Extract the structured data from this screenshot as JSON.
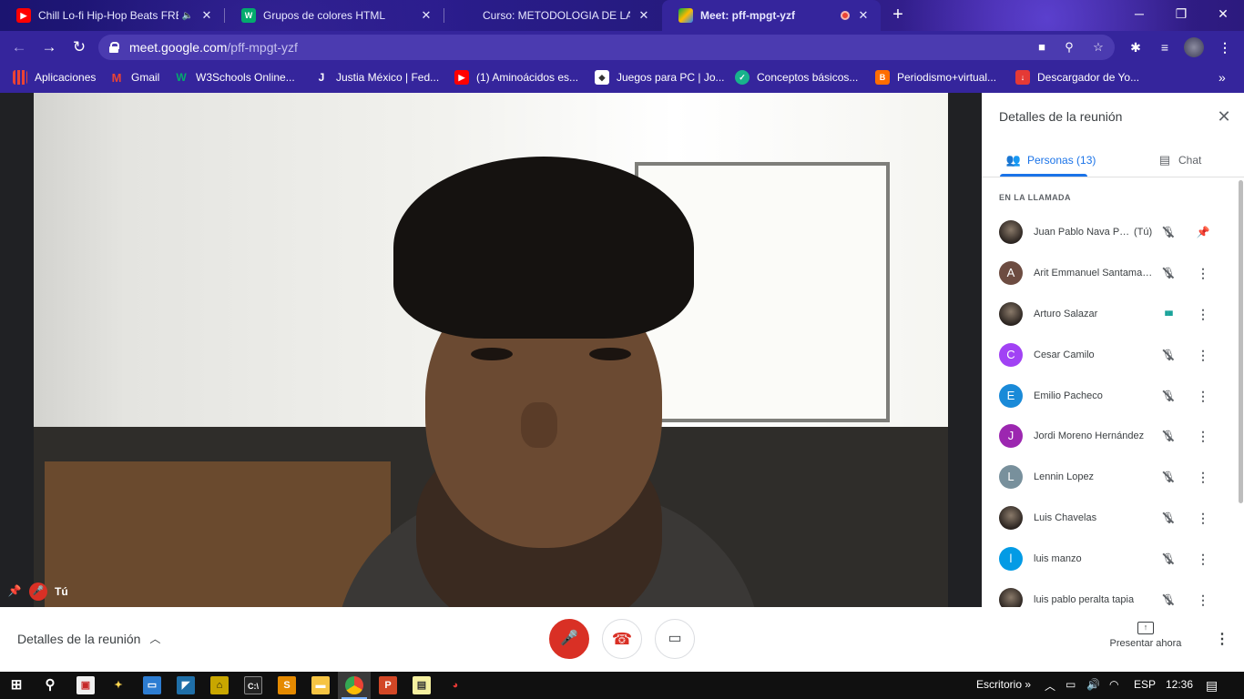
{
  "browser": {
    "tabs": [
      {
        "title": "Chill Lo-fi Hip-Hop Beats FREE",
        "icon": "youtube-icon",
        "audio": "🔈"
      },
      {
        "title": "Grupos de colores HTML",
        "icon": "w3schools-icon"
      },
      {
        "title": "Curso: METODOLOGIA DE LA INVESTIGACIÓN",
        "icon": "moodle-icon"
      },
      {
        "title": "Meet: pff-mpgt-yzf",
        "icon": "meet-icon",
        "recording": true
      }
    ],
    "url_host": "meet.google.com",
    "url_path": "/pff-mpgt-yzf",
    "bookmarks": [
      {
        "label": "Aplicaciones",
        "icon": "apps-grid-icon"
      },
      {
        "label": "Gmail",
        "icon": "gmail-icon"
      },
      {
        "label": "W3Schools Online...",
        "icon": "w3schools-icon"
      },
      {
        "label": "Justia México | Fed...",
        "icon": "justia-icon"
      },
      {
        "label": "(1) Aminoácidos es...",
        "icon": "youtube-icon"
      },
      {
        "label": "Juegos para PC | Jo...",
        "icon": "games-icon"
      },
      {
        "label": "Conceptos básicos...",
        "icon": "check-icon"
      },
      {
        "label": "Periodismo+virtual...",
        "icon": "blogger-icon"
      },
      {
        "label": "Descargador de Yo...",
        "icon": "download-icon"
      }
    ],
    "bookmarks_more": "»"
  },
  "meet": {
    "self_label": "Tú",
    "panel": {
      "title": "Detalles de la reunión",
      "tab_people": "Personas (13)",
      "tab_chat": "Chat",
      "section": "EN LA LLAMADA",
      "you_suffix": "(Tú)",
      "participants": [
        {
          "name": "Juan Pablo Nava Pa...",
          "initial": "",
          "color": "#5a4fc4",
          "photo": true,
          "you": true,
          "status": "muted"
        },
        {
          "name": "Arit Emmanuel Santamaría",
          "initial": "A",
          "color": "#6d4c41",
          "status": "muted"
        },
        {
          "name": "Arturo Salazar",
          "initial": "",
          "color": "#3e2f25",
          "photo": true,
          "status": "speaking"
        },
        {
          "name": "Cesar Camilo",
          "initial": "C",
          "color": "#a142f4",
          "status": "muted"
        },
        {
          "name": "Emilio Pacheco",
          "initial": "E",
          "color": "#1a8ad8",
          "status": "muted"
        },
        {
          "name": "Jordi Moreno Hernández",
          "initial": "J",
          "color": "#9c27b0",
          "status": "muted"
        },
        {
          "name": "Lennin Lopez",
          "initial": "L",
          "color": "#78909c",
          "status": "muted"
        },
        {
          "name": "Luis Chavelas",
          "initial": "",
          "color": "#4a5a6a",
          "photo": true,
          "status": "muted"
        },
        {
          "name": "luis manzo",
          "initial": "l",
          "color": "#039be5",
          "status": "muted"
        },
        {
          "name": "luis pablo peralta tapia",
          "initial": "",
          "color": "#b0b8c0",
          "photo": true,
          "status": "muted"
        }
      ]
    },
    "bottom": {
      "details_label": "Detalles de la reunión",
      "present_label": "Presentar ahora"
    }
  },
  "taskbar": {
    "desktop_label": "Escritorio",
    "more": "»",
    "language": "ESP",
    "time": "12:36"
  },
  "colors": {
    "meet_red": "#d93025",
    "meet_blue": "#1a73e8",
    "theme_purple": "#35259c"
  }
}
